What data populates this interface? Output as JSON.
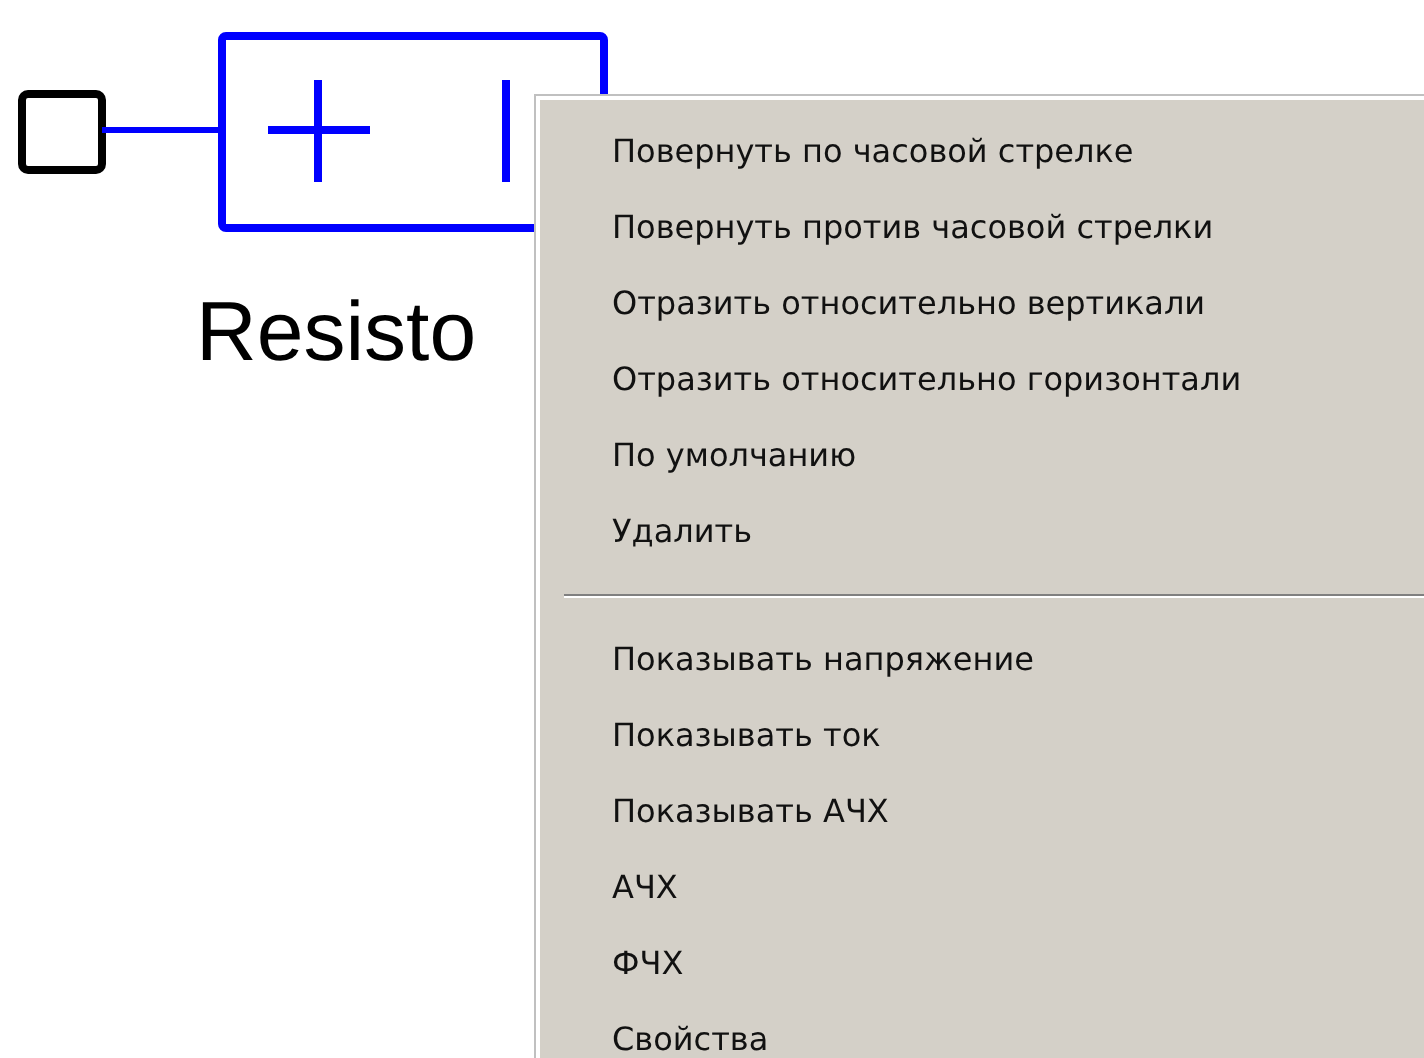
{
  "canvas": {
    "component_label": "Resisto"
  },
  "context_menu": {
    "groups": [
      {
        "items": [
          {
            "label": "Повернуть по часовой стрелке"
          },
          {
            "label": "Повернуть против часовой стрелки"
          },
          {
            "label": "Отразить относительно вертикали"
          },
          {
            "label": "Отразить относительно горизонтали"
          },
          {
            "label": "По умолчанию"
          },
          {
            "label": "Удалить"
          }
        ]
      },
      {
        "items": [
          {
            "label": "Показывать напряжение"
          },
          {
            "label": "Показывать ток"
          },
          {
            "label": "Показывать АЧХ"
          },
          {
            "label": "АЧХ"
          },
          {
            "label": "ФЧХ"
          },
          {
            "label": "Свойства"
          }
        ]
      }
    ]
  }
}
